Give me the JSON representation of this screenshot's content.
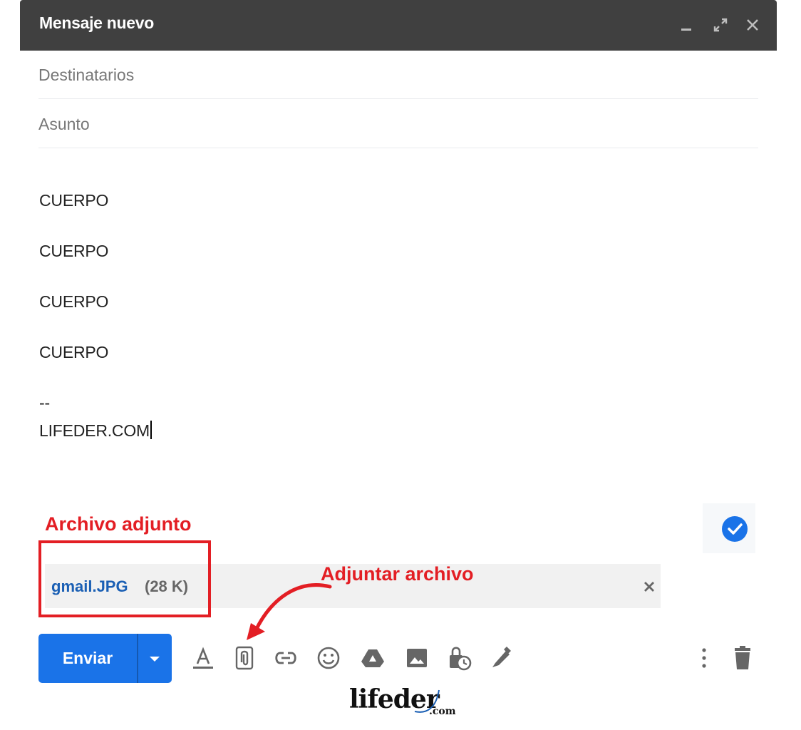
{
  "window": {
    "title": "Mensaje nuevo",
    "minimize_icon": "minimize-icon",
    "expand_icon": "expand-icon",
    "close_icon": "close-icon"
  },
  "fields": {
    "recipients_placeholder": "Destinatarios",
    "subject_placeholder": "Asunto"
  },
  "body": {
    "lines": [
      "CUERPO",
      "CUERPO",
      "CUERPO",
      "CUERPO"
    ],
    "signature_separator": "--",
    "signature": "LIFEDER.COM"
  },
  "annotations": {
    "attachment_label": "Archivo adjunto",
    "attach_action_label": "Adjuntar archivo",
    "color": "#e31e24"
  },
  "attachment": {
    "name": "gmail.JPG",
    "size": "(28 K)"
  },
  "toolbar": {
    "send_label": "Enviar",
    "accent_color": "#1a73e8",
    "icons": [
      "format-text-icon",
      "attach-file-icon",
      "insert-link-icon",
      "emoji-icon",
      "drive-icon",
      "insert-photo-icon",
      "confidential-mode-icon",
      "signature-icon",
      "more-options-icon",
      "discard-draft-icon"
    ]
  },
  "branding": {
    "logo_main": "lifeder",
    "logo_suffix": ".com"
  }
}
